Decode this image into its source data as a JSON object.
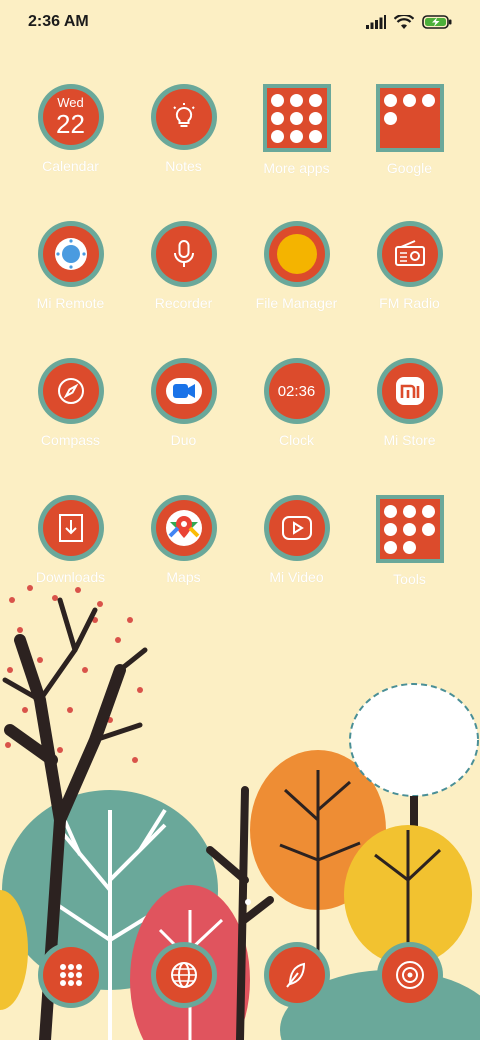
{
  "status_bar": {
    "time": "2:36 AM",
    "icons": [
      "signal-icon",
      "wifi-icon",
      "battery-charging-icon"
    ],
    "battery_color": "#4caf3a"
  },
  "apps": [
    {
      "label": "Calendar",
      "icon": "calendar-icon",
      "day": "Wed",
      "date": "22"
    },
    {
      "label": "Notes",
      "icon": "lightbulb-icon"
    },
    {
      "label": "More apps",
      "icon": "folder-icon"
    },
    {
      "label": "Google",
      "icon": "folder-icon"
    },
    {
      "label": "Mi Remote",
      "icon": "remote-icon"
    },
    {
      "label": "Recorder",
      "icon": "microphone-icon"
    },
    {
      "label": "File Manager",
      "icon": "file-manager-icon"
    },
    {
      "label": "FM Radio",
      "icon": "radio-icon"
    },
    {
      "label": "Compass",
      "icon": "compass-icon"
    },
    {
      "label": "Duo",
      "icon": "video-camera-icon"
    },
    {
      "label": "Clock",
      "icon": "clock-icon",
      "time": "02:36"
    },
    {
      "label": "Mi Store",
      "icon": "mi-logo-icon",
      "logo_text": "mi"
    },
    {
      "label": "Downloads",
      "icon": "download-icon"
    },
    {
      "label": "Maps",
      "icon": "maps-icon"
    },
    {
      "label": "Mi Video",
      "icon": "play-icon"
    },
    {
      "label": "Tools",
      "icon": "folder-icon"
    }
  ],
  "dock": [
    {
      "icon": "app-drawer-icon"
    },
    {
      "icon": "globe-icon"
    },
    {
      "icon": "feather-icon"
    },
    {
      "icon": "camera-icon"
    }
  ],
  "colors": {
    "background": "#fcefc4",
    "icon_fill": "#dc4b2c",
    "icon_ring": "#6aa89a",
    "file_manager_dot": "#f4b400",
    "remote_dot": "#4a9be0"
  }
}
